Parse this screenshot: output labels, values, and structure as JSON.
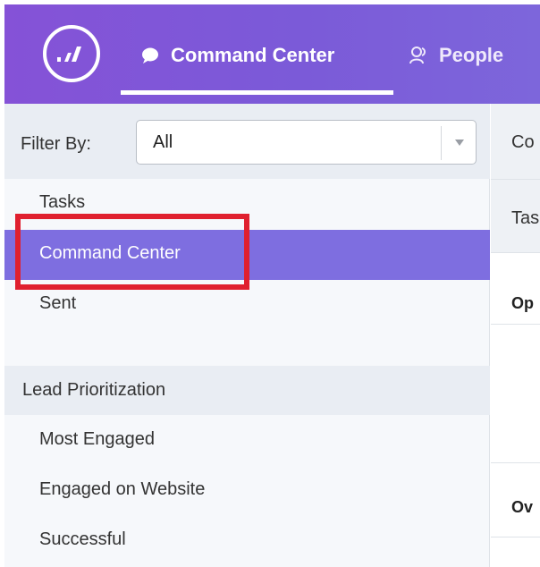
{
  "header": {
    "logo_icon": "marketo-logo-icon",
    "tabs": [
      {
        "label": "Command Center",
        "icon": "chat-bubble-icon",
        "active": true
      },
      {
        "label": "People",
        "icon": "people-icon",
        "active": false
      }
    ]
  },
  "filter": {
    "label": "Filter By:",
    "value": "All"
  },
  "sidebar": {
    "items": [
      {
        "label": "Tasks"
      },
      {
        "label": "Command Center",
        "active": true
      },
      {
        "label": "Sent"
      }
    ],
    "section": {
      "title": "Lead Prioritization",
      "items": [
        {
          "label": "Most Engaged"
        },
        {
          "label": "Engaged on Website"
        },
        {
          "label": "Successful"
        }
      ]
    }
  },
  "main": {
    "title": "Co",
    "column_header": "Tas",
    "rows": [
      "Op",
      "Ov"
    ]
  },
  "colors": {
    "header_purple": "#7b5ad8",
    "active_item": "#7e6ee0",
    "highlight_red": "#e0202f"
  }
}
